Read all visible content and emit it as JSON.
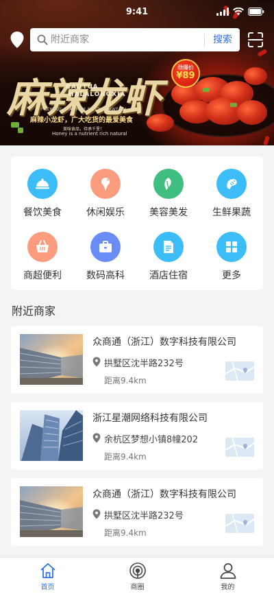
{
  "status_bar": {
    "time": "9:41"
  },
  "search": {
    "placeholder": "附近商家",
    "button_label": "搜索"
  },
  "banner": {
    "title": "麻辣龙虾",
    "pinyin_1": "BAOTUA",
    "pinyin_2": "HALALONGXIA",
    "english_tag": "PACKAGE DIAGRAM SPICY CRAWFISH",
    "slogan": "麻辣小龙虾，广大吃货的最爱美食",
    "small_text_1": "美味食品，待承千里！",
    "small_text_2": "Honey is a nutrient rich natural",
    "badge_label": "劲爆价",
    "badge_price": "¥89"
  },
  "categories": [
    {
      "label": "餐饮美食",
      "icon": "dining-cloche-icon",
      "color": "#3dbdf7"
    },
    {
      "label": "休闲娱乐",
      "icon": "ice-cream-icon",
      "color": "#fc9c7e"
    },
    {
      "label": "美容美发",
      "icon": "beauty-leaf-icon",
      "color": "#3fbf7f"
    },
    {
      "label": "生鲜果蔬",
      "icon": "shrimp-icon",
      "color": "#3dbdf7"
    },
    {
      "label": "商超便利",
      "icon": "shopping-basket-icon",
      "color": "#fc9c7e"
    },
    {
      "label": "数码高科",
      "icon": "briefcase-icon",
      "color": "#6a8cf6"
    },
    {
      "label": "酒店住宿",
      "icon": "hotel-document-icon",
      "color": "#3dbdf7"
    },
    {
      "label": "更多",
      "icon": "more-grid-icon",
      "color": "#3dbdf7"
    }
  ],
  "section_title": "附近商家",
  "merchants": [
    {
      "name": "众商通（浙江）数字科技有限公司",
      "address": "拱墅区沈半路232号",
      "distance": "距离9.4km"
    },
    {
      "name": "浙江星潮网络科技有限公司",
      "address": "余杭区梦想小镇8幢202",
      "distance": "距离9.4km"
    },
    {
      "name": "众商通（浙江）数字科技有限公司",
      "address": "拱墅区沈半路232号",
      "distance": "距离9.4km"
    }
  ],
  "tabs": [
    {
      "label": "首页",
      "icon": "home-icon",
      "active": true
    },
    {
      "label": "商圈",
      "icon": "business-circle-icon",
      "active": false
    },
    {
      "label": "我的",
      "icon": "user-icon",
      "active": false
    }
  ],
  "colors": {
    "accent": "#2f72e6",
    "background": "#f3f4f6"
  }
}
